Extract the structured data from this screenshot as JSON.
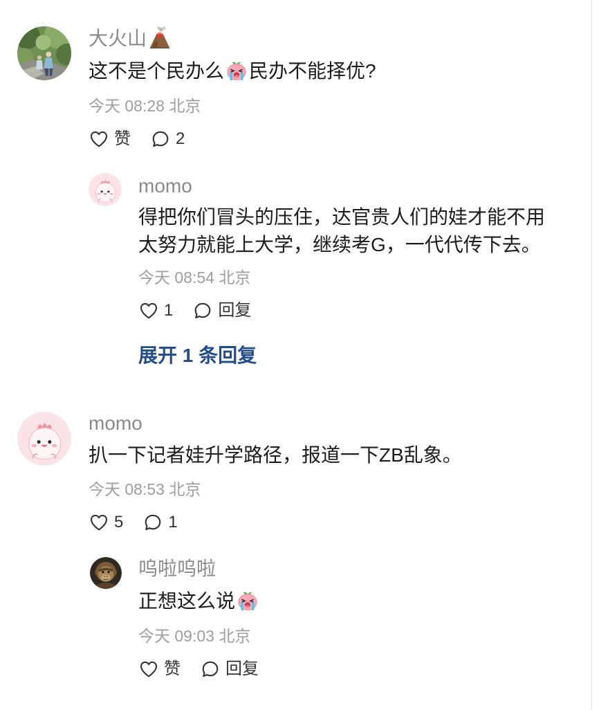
{
  "colors": {
    "text": "#1c1c1c",
    "username": "#8a8a8a",
    "timestamp": "#9e9e9e",
    "link": "#244d89",
    "icon": "#333333"
  },
  "icons": {
    "like": "heart-icon",
    "reply": "comment-bubble-icon",
    "username_emoji": "volcano-emoji-icon",
    "sticker": "crying-face-sticker-icon"
  },
  "comments": [
    {
      "username": "大火山",
      "content_before_emoji": "这不是个民办么",
      "content_after_emoji": "民办不能择优?",
      "timestamp": "今天 08:28 北京",
      "like_label": "赞",
      "reply_label": "2",
      "replies": [
        {
          "username": "momo",
          "content": "得把你们冒头的压住，达官贵人们的娃才能不用太努力就能上大学，继续考G，一代代传下去。",
          "timestamp": "今天 08:54 北京",
          "like_label": "1",
          "reply_label": "回复"
        }
      ],
      "expand_label": "展开 1 条回复"
    },
    {
      "username": "momo",
      "content": "扒一下记者娃升学路径，报道一下ZB乱象。",
      "timestamp": "今天 08:53 北京",
      "like_label": "5",
      "reply_label": "1",
      "replies": [
        {
          "username": "呜啦呜啦",
          "content_before_emoji": "正想这么说",
          "timestamp": "今天 09:03 北京",
          "like_label": "赞",
          "reply_label": "回复"
        }
      ]
    }
  ]
}
